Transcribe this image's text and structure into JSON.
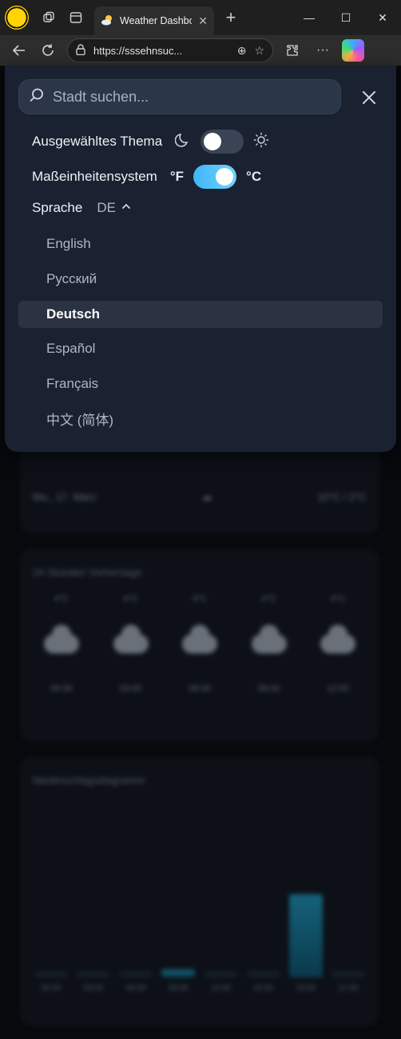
{
  "browser": {
    "tab_title": "Weather Dashbo",
    "url": "https://sssehnsuc..."
  },
  "search": {
    "placeholder": "Stadt suchen..."
  },
  "settings": {
    "theme_label": "Ausgewähltes Thema",
    "theme_dark": true,
    "units_label": "Maßeinheitensystem",
    "unit_f": "°F",
    "unit_c": "°C",
    "unit_selected": "°C",
    "language_label": "Sprache",
    "language_code": "DE"
  },
  "languages": [
    {
      "label": "English",
      "selected": false
    },
    {
      "label": "Русский",
      "selected": false
    },
    {
      "label": "Deutsch",
      "selected": true
    },
    {
      "label": "Español",
      "selected": false
    },
    {
      "label": "Français",
      "selected": false
    },
    {
      "label": "中文 (简体)",
      "selected": false
    }
  ],
  "colors": {
    "panel_bg": "#1a2130",
    "accent": "#3fb6f5",
    "selected_item_bg": "#2b3242"
  },
  "icons": [
    "search-icon",
    "close-icon",
    "moon-icon",
    "sun-icon",
    "chevron-up-icon"
  ]
}
